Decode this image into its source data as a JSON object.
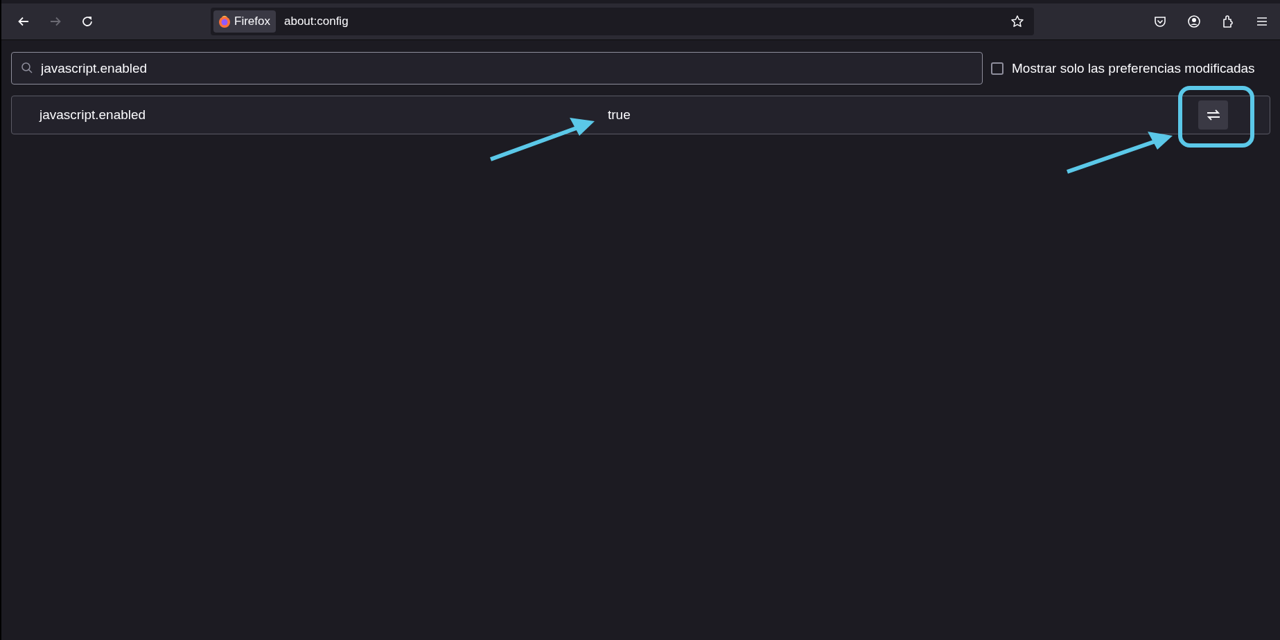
{
  "toolbar": {
    "nav_buttons": [
      {
        "kind": "back",
        "disabled": false
      },
      {
        "kind": "forward",
        "disabled": true
      },
      {
        "kind": "reload",
        "disabled": false
      }
    ],
    "identity_label": "Firefox",
    "url": "about:config"
  },
  "search": {
    "value": "javascript.enabled"
  },
  "modified_only": {
    "label": "Mostrar solo las preferencias modificadas",
    "checked": false
  },
  "preferences": [
    {
      "name": "javascript.enabled",
      "value": "true"
    }
  ]
}
